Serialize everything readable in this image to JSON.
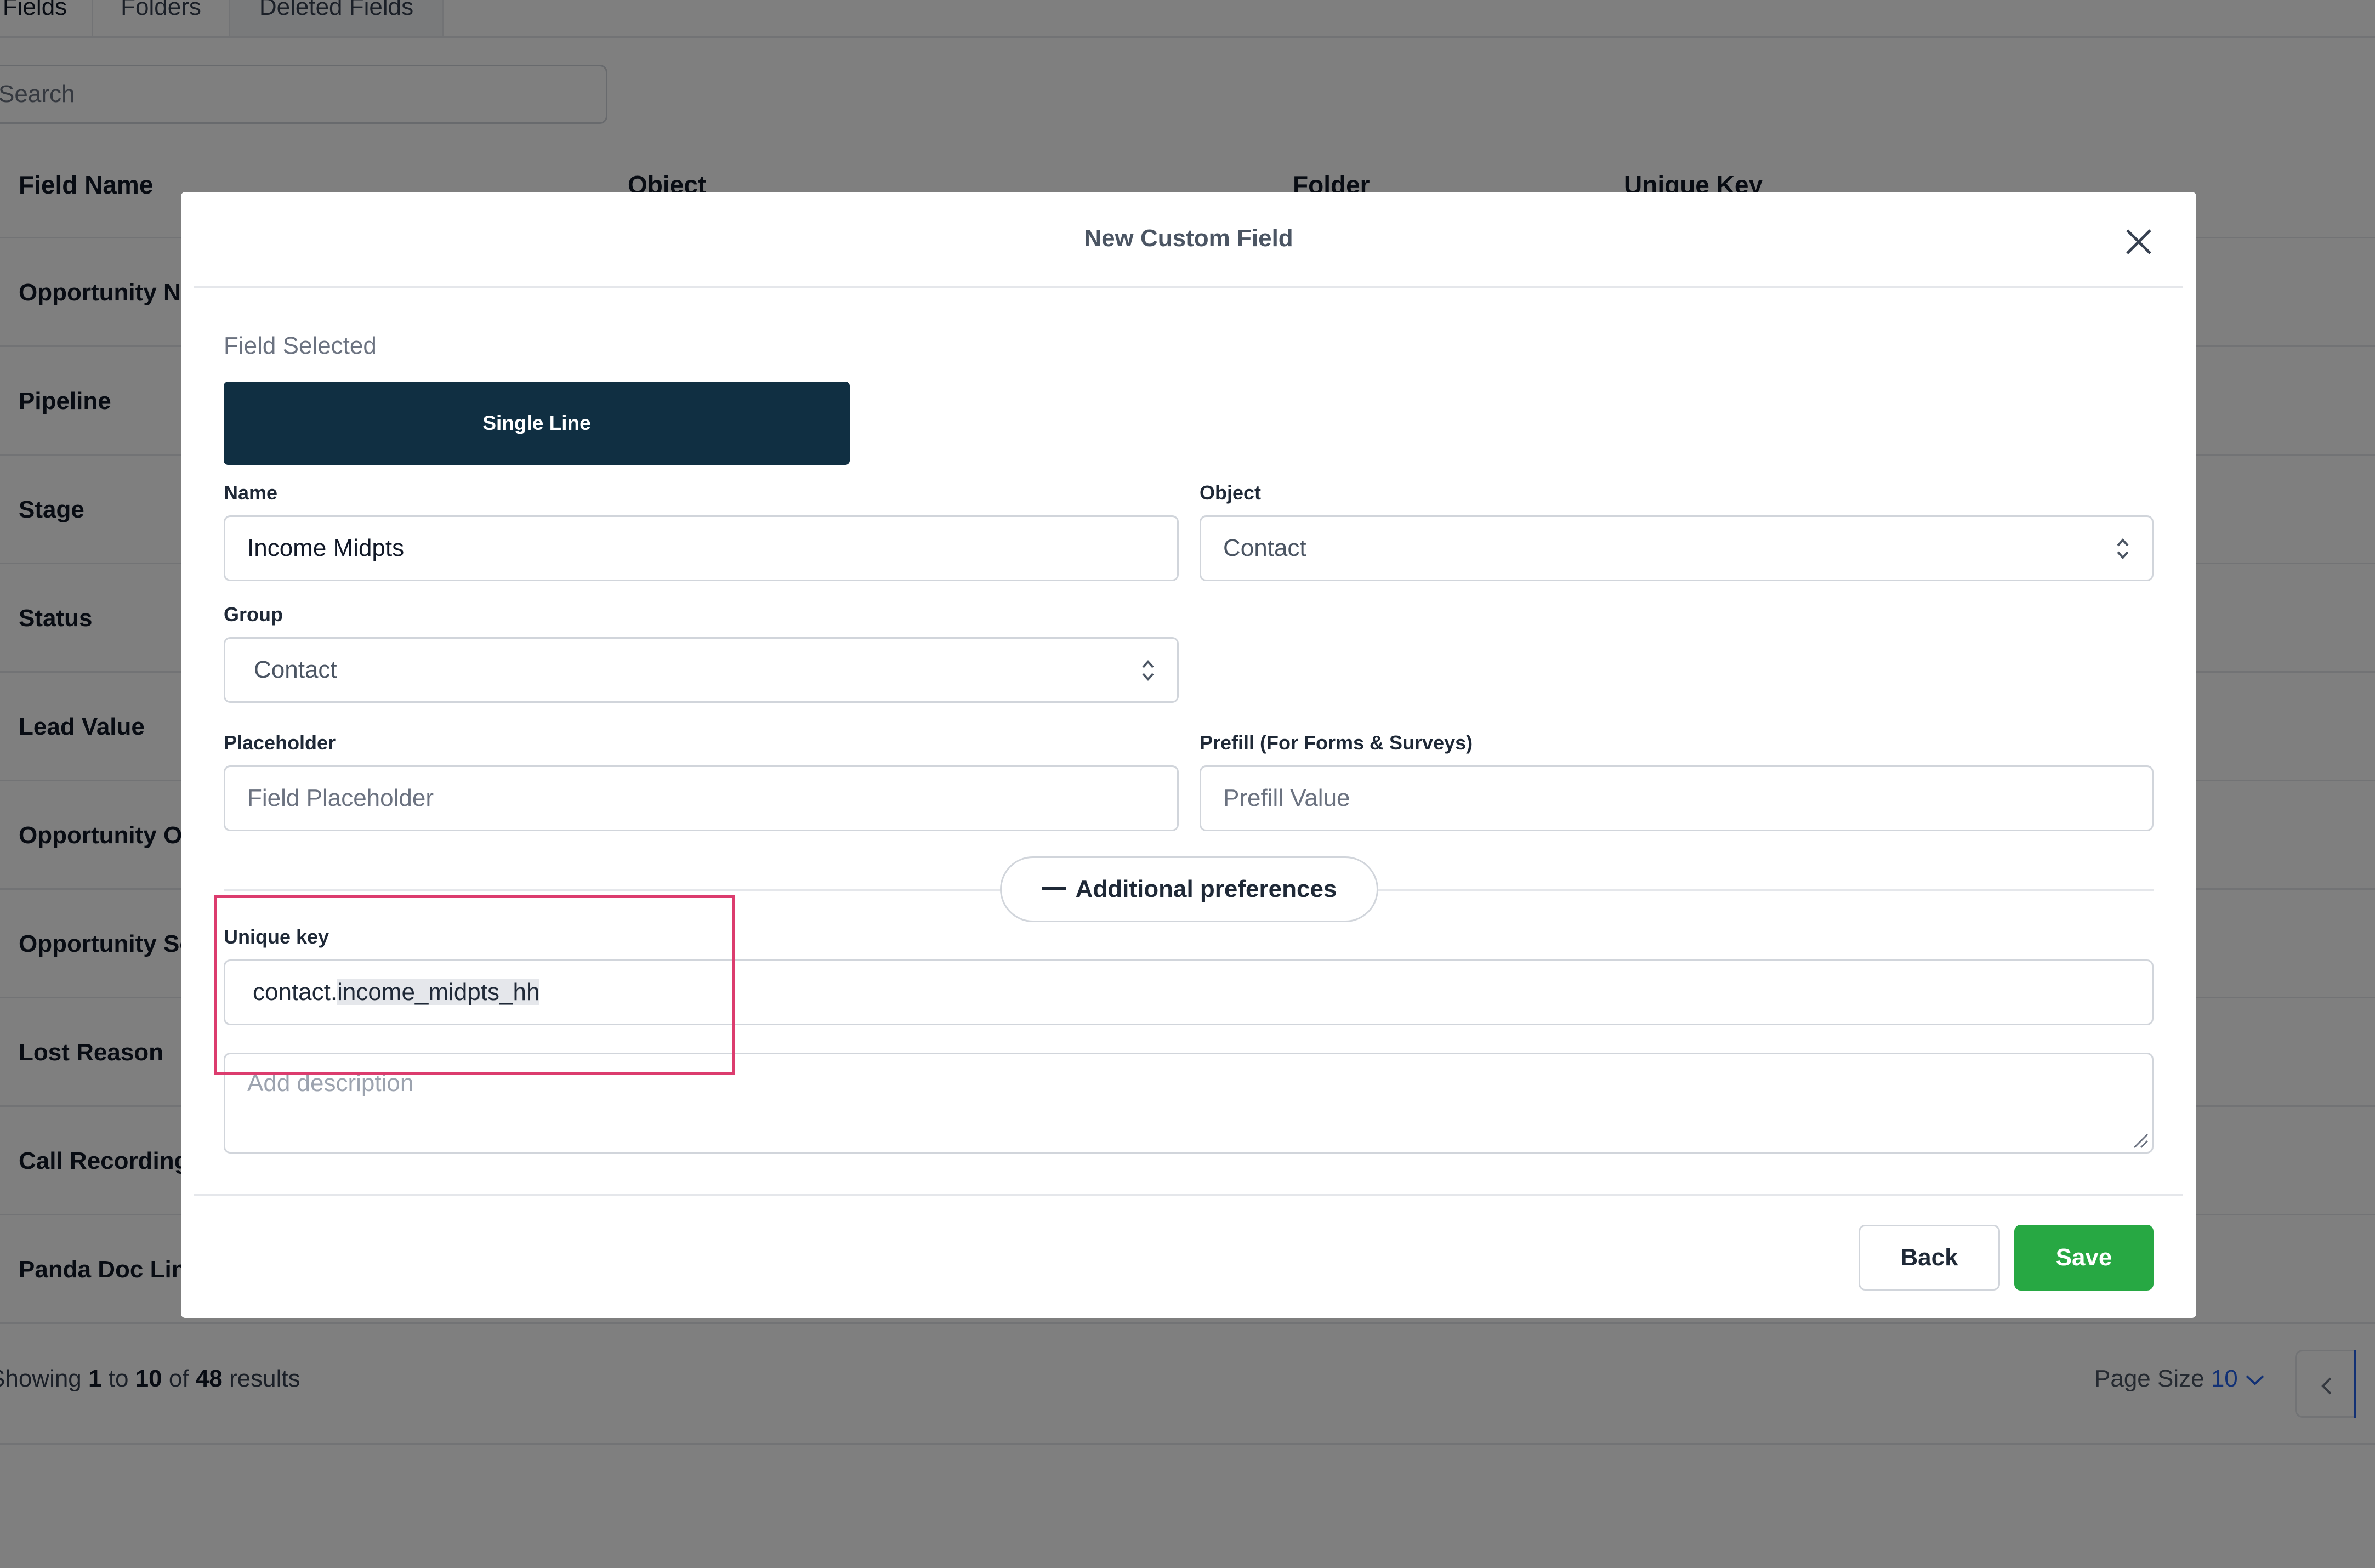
{
  "tabs": [
    "Fields",
    "Folders",
    "Deleted Fields"
  ],
  "search": {
    "placeholder": "Search"
  },
  "table": {
    "headers": [
      "Field Name",
      "Object",
      "Folder",
      "Unique Key"
    ],
    "rows": [
      "Opportunity Name",
      "Pipeline",
      "Stage",
      "Status",
      "Lead Value",
      "Opportunity Owner",
      "Opportunity Source",
      "Lost Reason",
      "Call Recording",
      "Panda Doc Link"
    ]
  },
  "footer": {
    "prefix": "Showing",
    "from": "1",
    "to_word": "to",
    "to": "10",
    "of_word": "of",
    "total": "48",
    "suffix": "results",
    "page_size_label": "Page Size",
    "page_size_value": "10"
  },
  "modal": {
    "title": "New Custom Field",
    "field_selected_label": "Field Selected",
    "field_type": "Single Line",
    "name_label": "Name",
    "name_value": "Income Midpts",
    "object_label": "Object",
    "object_value": "Contact",
    "group_label": "Group",
    "group_value": "Contact",
    "placeholder_label": "Placeholder",
    "placeholder_input_placeholder": "Field Placeholder",
    "prefill_label": "Prefill (For Forms & Surveys)",
    "prefill_input_placeholder": "Prefill Value",
    "additional_preferences": "Additional preferences",
    "unique_key_label": "Unique key",
    "unique_key_prefix": "contact.",
    "unique_key_value": "income_midpts_hh",
    "description_placeholder": "Add description",
    "back_label": "Back",
    "save_label": "Save"
  },
  "colors": {
    "primary_dark": "#102f42",
    "save_green": "#27a843",
    "highlight": "#dc3c6e",
    "link_blue": "#2563eb"
  }
}
